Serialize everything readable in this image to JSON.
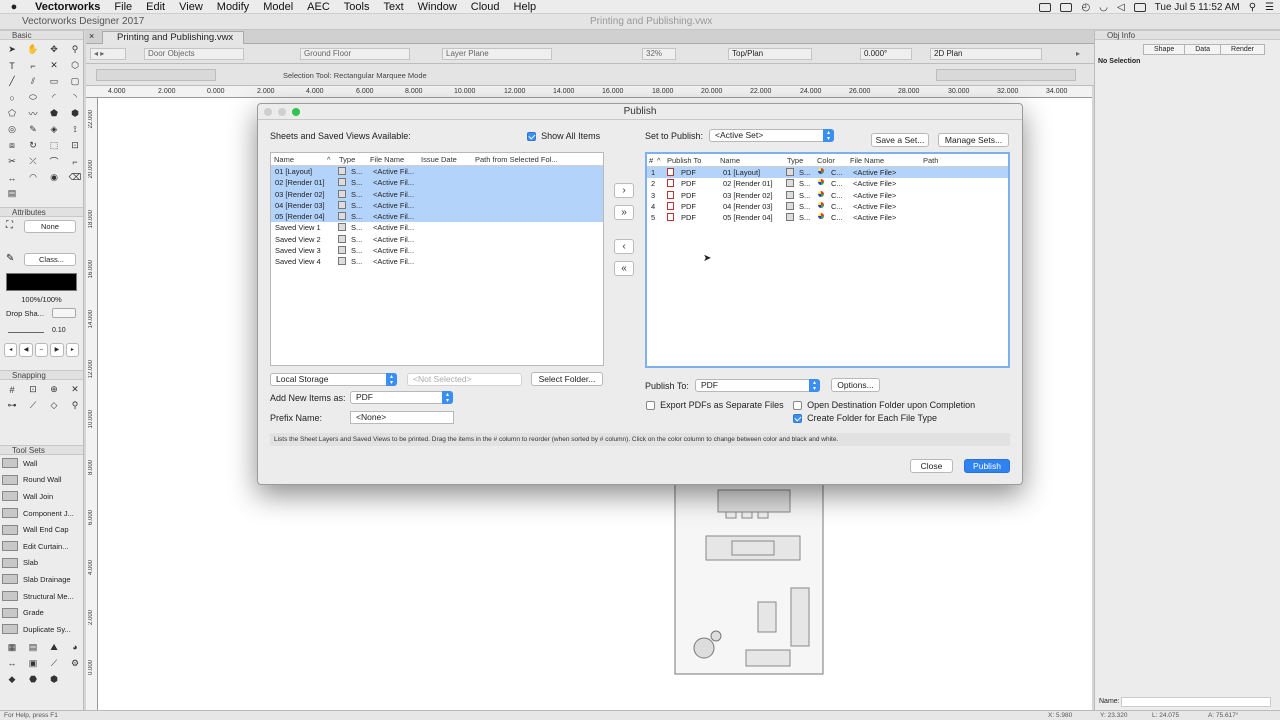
{
  "menubar": {
    "app": "Vectorworks",
    "items": [
      "File",
      "Edit",
      "View",
      "Modify",
      "Model",
      "AEC",
      "Tools",
      "Text",
      "Window",
      "Cloud",
      "Help"
    ],
    "clock": "Tue Jul 5  11:52 AM"
  },
  "app_title": "Vectorworks Designer 2017",
  "window_file": "Printing and Publishing.vwx",
  "doc_tab": "Printing and Publishing.vwx",
  "view_bar": {
    "class": "Door Objects",
    "layer": "Ground Floor",
    "plane": "Layer Plane",
    "zoom": "32%",
    "view": "Top/Plan",
    "angle": "0.000°",
    "render": "2D Plan"
  },
  "mode_bar": {
    "mode_text": "Selection Tool: Rectangular Marquee Mode"
  },
  "ruler_h": [
    "4.000",
    "2.000",
    "0.000",
    "2.000",
    "4.000",
    "6.000",
    "8.000",
    "10.000",
    "12.000",
    "14.000",
    "16.000",
    "18.000",
    "20.000",
    "22.000",
    "24.000",
    "26.000",
    "28.000",
    "30.000",
    "32.000",
    "34.000"
  ],
  "ruler_v": [
    "22.000",
    "20.000",
    "18.000",
    "16.000",
    "14.000",
    "12.000",
    "10.000",
    "8.000",
    "6.000",
    "4.000",
    "2.000",
    "0.000"
  ],
  "palettes": {
    "basic": "Basic",
    "attributes": "Attributes",
    "fill_none": "None",
    "pen_class": "Class...",
    "opacity": "100%/100%",
    "drop_shadow": "Drop Sha...",
    "line_weight": "0.10",
    "snapping": "Snapping",
    "tool_sets": "Tool Sets",
    "tool_set_items": [
      "Wall",
      "Round Wall",
      "Wall Join",
      "Component J...",
      "Wall End Cap",
      "Edit Curtain...",
      "Slab",
      "Slab Drainage",
      "Structural Me...",
      "Grade",
      "Duplicate Sy..."
    ]
  },
  "obj_info": {
    "title": "Obj Info",
    "tabs": [
      "Shape",
      "Data",
      "Render"
    ],
    "selection": "No Selection",
    "name_label": "Name:"
  },
  "status": {
    "help": "For Help, press F1",
    "coords": [
      "X: 5.980",
      "Y: 23.320",
      "L: 24.075",
      "A: 75.617°"
    ]
  },
  "dialog": {
    "title": "Publish",
    "left_heading": "Sheets and Saved Views Available:",
    "show_all": "Show All Items",
    "left_columns": [
      "Name",
      "Type",
      "File Name",
      "Issue Date",
      "Path from Selected Fol..."
    ],
    "left_rows": [
      {
        "name": "01 [Layout]",
        "type": "S...",
        "file": "<Active Fil..."
      },
      {
        "name": "02 [Render 01]",
        "type": "S...",
        "file": "<Active Fil..."
      },
      {
        "name": "03 [Render 02]",
        "type": "S...",
        "file": "<Active Fil..."
      },
      {
        "name": "04 [Render 03]",
        "type": "S...",
        "file": "<Active Fil..."
      },
      {
        "name": "05 [Render 04]",
        "type": "S...",
        "file": "<Active Fil..."
      },
      {
        "name": "Saved View 1",
        "type": "S...",
        "file": "<Active Fil..."
      },
      {
        "name": "Saved View 2",
        "type": "S...",
        "file": "<Active Fil..."
      },
      {
        "name": "Saved View 3",
        "type": "S...",
        "file": "<Active Fil..."
      },
      {
        "name": "Saved View 4",
        "type": "S...",
        "file": "<Active Fil..."
      }
    ],
    "storage": "Local Storage",
    "not_selected": "<Not Selected>",
    "select_folder": "Select Folder...",
    "add_new_label": "Add New Items as:",
    "add_new_value": "PDF",
    "prefix_label": "Prefix Name:",
    "prefix_value": "<None>",
    "set_label": "Set to Publish:",
    "set_value": "<Active Set>",
    "save_set": "Save a Set...",
    "manage_sets": "Manage Sets...",
    "right_columns": [
      "#",
      "Publish To",
      "Name",
      "Type",
      "Color",
      "File Name",
      "Path"
    ],
    "right_rows": [
      {
        "num": "1",
        "to": "PDF",
        "name": "01 [Layout]",
        "type": "S...",
        "color": "C...",
        "file": "<Active File>"
      },
      {
        "num": "2",
        "to": "PDF",
        "name": "02 [Render 01]",
        "type": "S...",
        "color": "C...",
        "file": "<Active File>"
      },
      {
        "num": "3",
        "to": "PDF",
        "name": "03 [Render 02]",
        "type": "S...",
        "color": "C...",
        "file": "<Active File>"
      },
      {
        "num": "4",
        "to": "PDF",
        "name": "04 [Render 03]",
        "type": "S...",
        "color": "C...",
        "file": "<Active File>"
      },
      {
        "num": "5",
        "to": "PDF",
        "name": "05 [Render 04]",
        "type": "S...",
        "color": "C...",
        "file": "<Active File>"
      }
    ],
    "publish_to_label": "Publish To:",
    "publish_to_value": "PDF",
    "options": "Options...",
    "export_separate": "Export PDFs as Separate Files",
    "open_dest": "Open Destination Folder upon Completion",
    "create_folder": "Create Folder for Each File Type",
    "help_text": "Lists the Sheet Layers and Saved Views to be printed.  Drag the items in the # column to reorder (when sorted by # column).  Click on the color column to change between color and black and white.",
    "close": "Close",
    "publish": "Publish",
    "arrows": {
      "add": "›",
      "add_all": "»",
      "remove": "‹",
      "remove_all": "«"
    }
  }
}
